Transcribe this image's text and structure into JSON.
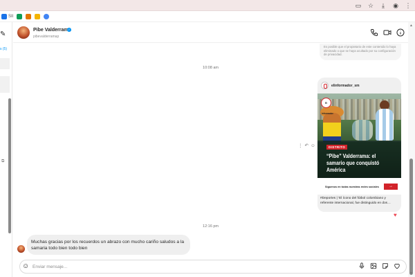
{
  "browser": {
    "bookmarks": [
      {
        "label": "SII",
        "color": "#1a73e8"
      },
      {
        "label": "",
        "color": "#0f9d58"
      },
      {
        "label": "",
        "color": "#e37400"
      },
      {
        "label": "",
        "color": "#f4b400"
      },
      {
        "label": "",
        "color": "#4285f4"
      }
    ]
  },
  "sidebar": {
    "requests_label": "s (5)"
  },
  "header": {
    "name": "Pibe Valderrama",
    "username": "pibevalderramap",
    "verified": true
  },
  "messages": {
    "privacy_note": "Es posible que el propietario de este contenido lo haya eliminado o que se haya ocultado por su configuración de privacidad.",
    "timestamp_1": "10:08 am",
    "timestamp_2": "12:16 pm",
    "shared_post": {
      "author": "elinformador_sm",
      "logo_text": "El Informador",
      "tag": "DISTRITO",
      "headline": "“Pibe” Valderrama: el samario que conquistó América",
      "follow_text": "Síguenos en todas nuestras redes sociales",
      "follow_button": "→",
      "caption": "#Deportes | ‘El ícono del fútbol colombiano y referente internacional, fue distinguido en dos…",
      "reaction": "♥"
    },
    "incoming": {
      "text": "Muchas gracias por los recuerdos un abrazo con mucho cariño saludos a la samaria todo bien todo bien"
    }
  },
  "composer": {
    "placeholder": "Enviar mensaje..."
  },
  "colors": {
    "accent_blue": "#0095f6",
    "brand_red": "#d2232a",
    "heart": "#ed4956"
  }
}
